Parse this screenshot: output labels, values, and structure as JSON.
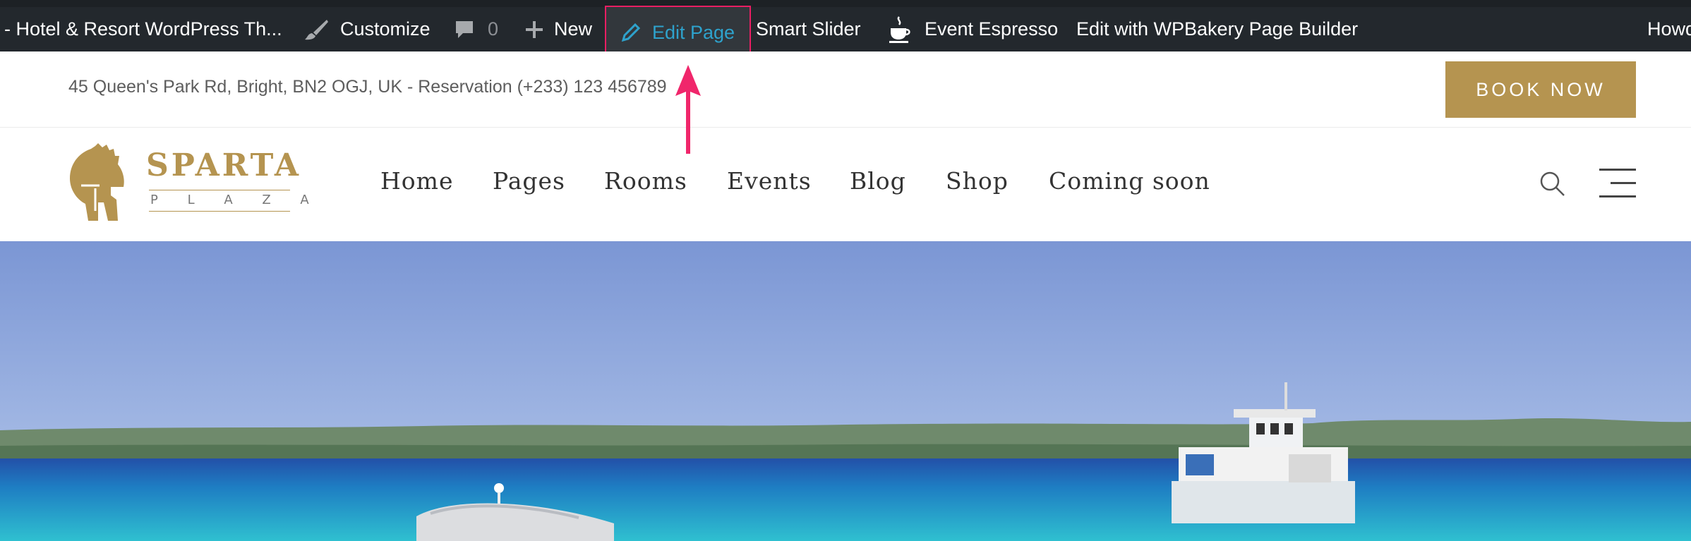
{
  "adminbar": {
    "site_title": "- Hotel & Resort WordPress Th...",
    "customize": "Customize",
    "comments_count": "0",
    "new": "New",
    "edit_page": "Edit Page",
    "smart_slider": "Smart Slider",
    "event_espresso": "Event Espresso",
    "wpbakery": "Edit with WPBakery Page Builder",
    "howdy": "Howd"
  },
  "infobar": {
    "address": "45 Queen's Park Rd, Bright, BN2 OGJ, UK  -  Reservation (+233) 123 456789",
    "book_now": "BOOK NOW"
  },
  "logo": {
    "name": "SPARTA",
    "tagline": "P L A Z A"
  },
  "nav": [
    "Home",
    "Pages",
    "Rooms",
    "Events",
    "Blog",
    "Shop",
    "Coming soon"
  ],
  "icons": {
    "brush": "brush-icon",
    "comment": "comment-bubble-icon",
    "plus": "plus-icon",
    "pencil": "pencil-icon",
    "espresso": "coffee-cup-icon",
    "search": "search-icon",
    "menu": "hamburger-menu-icon"
  },
  "colors": {
    "adminbar_bg": "#23282d",
    "accent_gold": "#b59450",
    "edit_link": "#2ea2cc",
    "highlight": "#e91e63"
  }
}
